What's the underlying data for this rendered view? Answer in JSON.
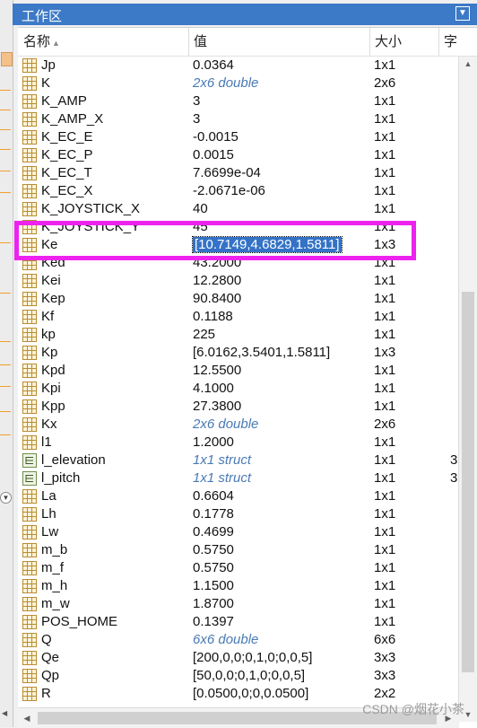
{
  "panel": {
    "title": "工作区",
    "columns": {
      "name": "名称",
      "value": "值",
      "size": "大小",
      "class": "字"
    }
  },
  "variables": [
    {
      "name": "Jp",
      "value": "0.0364",
      "size": "1x1",
      "italic": false
    },
    {
      "name": "K",
      "value": "2x6 double",
      "size": "2x6",
      "italic": true
    },
    {
      "name": "K_AMP",
      "value": "3",
      "size": "1x1",
      "italic": false
    },
    {
      "name": "K_AMP_X",
      "value": "3",
      "size": "1x1",
      "italic": false
    },
    {
      "name": "K_EC_E",
      "value": "-0.0015",
      "size": "1x1",
      "italic": false
    },
    {
      "name": "K_EC_P",
      "value": "0.0015",
      "size": "1x1",
      "italic": false
    },
    {
      "name": "K_EC_T",
      "value": "7.6699e-04",
      "size": "1x1",
      "italic": false
    },
    {
      "name": "K_EC_X",
      "value": "-2.0671e-06",
      "size": "1x1",
      "italic": false
    },
    {
      "name": "K_JOYSTICK_X",
      "value": "40",
      "size": "1x1",
      "italic": false
    },
    {
      "name": "K_JOYSTICK_Y",
      "value": "45",
      "size": "1x1",
      "italic": false
    },
    {
      "name": "Ke",
      "value": "[10.7149,4.6829,1.5811]",
      "size": "1x3",
      "italic": false,
      "selected": true
    },
    {
      "name": "Ked",
      "value": "43.2000",
      "size": "1x1",
      "italic": false
    },
    {
      "name": "Kei",
      "value": "12.2800",
      "size": "1x1",
      "italic": false
    },
    {
      "name": "Kep",
      "value": "90.8400",
      "size": "1x1",
      "italic": false
    },
    {
      "name": "Kf",
      "value": "0.1188",
      "size": "1x1",
      "italic": false
    },
    {
      "name": "kp",
      "value": "225",
      "size": "1x1",
      "italic": false
    },
    {
      "name": "Kp",
      "value": "[6.0162,3.5401,1.5811]",
      "size": "1x3",
      "italic": false
    },
    {
      "name": "Kpd",
      "value": "12.5500",
      "size": "1x1",
      "italic": false
    },
    {
      "name": "Kpi",
      "value": "4.1000",
      "size": "1x1",
      "italic": false
    },
    {
      "name": "Kpp",
      "value": "27.3800",
      "size": "1x1",
      "italic": false
    },
    {
      "name": "Kx",
      "value": "2x6 double",
      "size": "2x6",
      "italic": true
    },
    {
      "name": "l1",
      "value": "1.2000",
      "size": "1x1",
      "italic": false
    },
    {
      "name": "l_elevation",
      "value": "1x1 struct",
      "size": "1x1",
      "italic": true,
      "icon": "struct",
      "cls": "3"
    },
    {
      "name": "l_pitch",
      "value": "1x1 struct",
      "size": "1x1",
      "italic": true,
      "icon": "struct",
      "cls": "3"
    },
    {
      "name": "La",
      "value": "0.6604",
      "size": "1x1",
      "italic": false
    },
    {
      "name": "Lh",
      "value": "0.1778",
      "size": "1x1",
      "italic": false
    },
    {
      "name": "Lw",
      "value": "0.4699",
      "size": "1x1",
      "italic": false
    },
    {
      "name": "m_b",
      "value": "0.5750",
      "size": "1x1",
      "italic": false
    },
    {
      "name": "m_f",
      "value": "0.5750",
      "size": "1x1",
      "italic": false
    },
    {
      "name": "m_h",
      "value": "1.1500",
      "size": "1x1",
      "italic": false
    },
    {
      "name": "m_w",
      "value": "1.8700",
      "size": "1x1",
      "italic": false
    },
    {
      "name": "POS_HOME",
      "value": "0.1397",
      "size": "1x1",
      "italic": false
    },
    {
      "name": "Q",
      "value": "6x6 double",
      "size": "6x6",
      "italic": true
    },
    {
      "name": "Qe",
      "value": "[200,0,0;0,1,0;0,0,5]",
      "size": "3x3",
      "italic": false
    },
    {
      "name": "Qp",
      "value": "[50,0,0;0,1,0;0,0,5]",
      "size": "3x3",
      "italic": false
    },
    {
      "name": "R",
      "value": "[0.0500,0;0,0.0500]",
      "size": "2x2",
      "italic": false
    }
  ],
  "watermark": "CSDN @烟花小茶",
  "colors": {
    "title_bar": "#3c79c6",
    "selection": "#3372c6",
    "highlight_box": "#ee22ee",
    "italic_value": "#4a7ab5"
  },
  "icons": {
    "variable": "matrix-grid-icon",
    "struct": "struct-icon"
  }
}
